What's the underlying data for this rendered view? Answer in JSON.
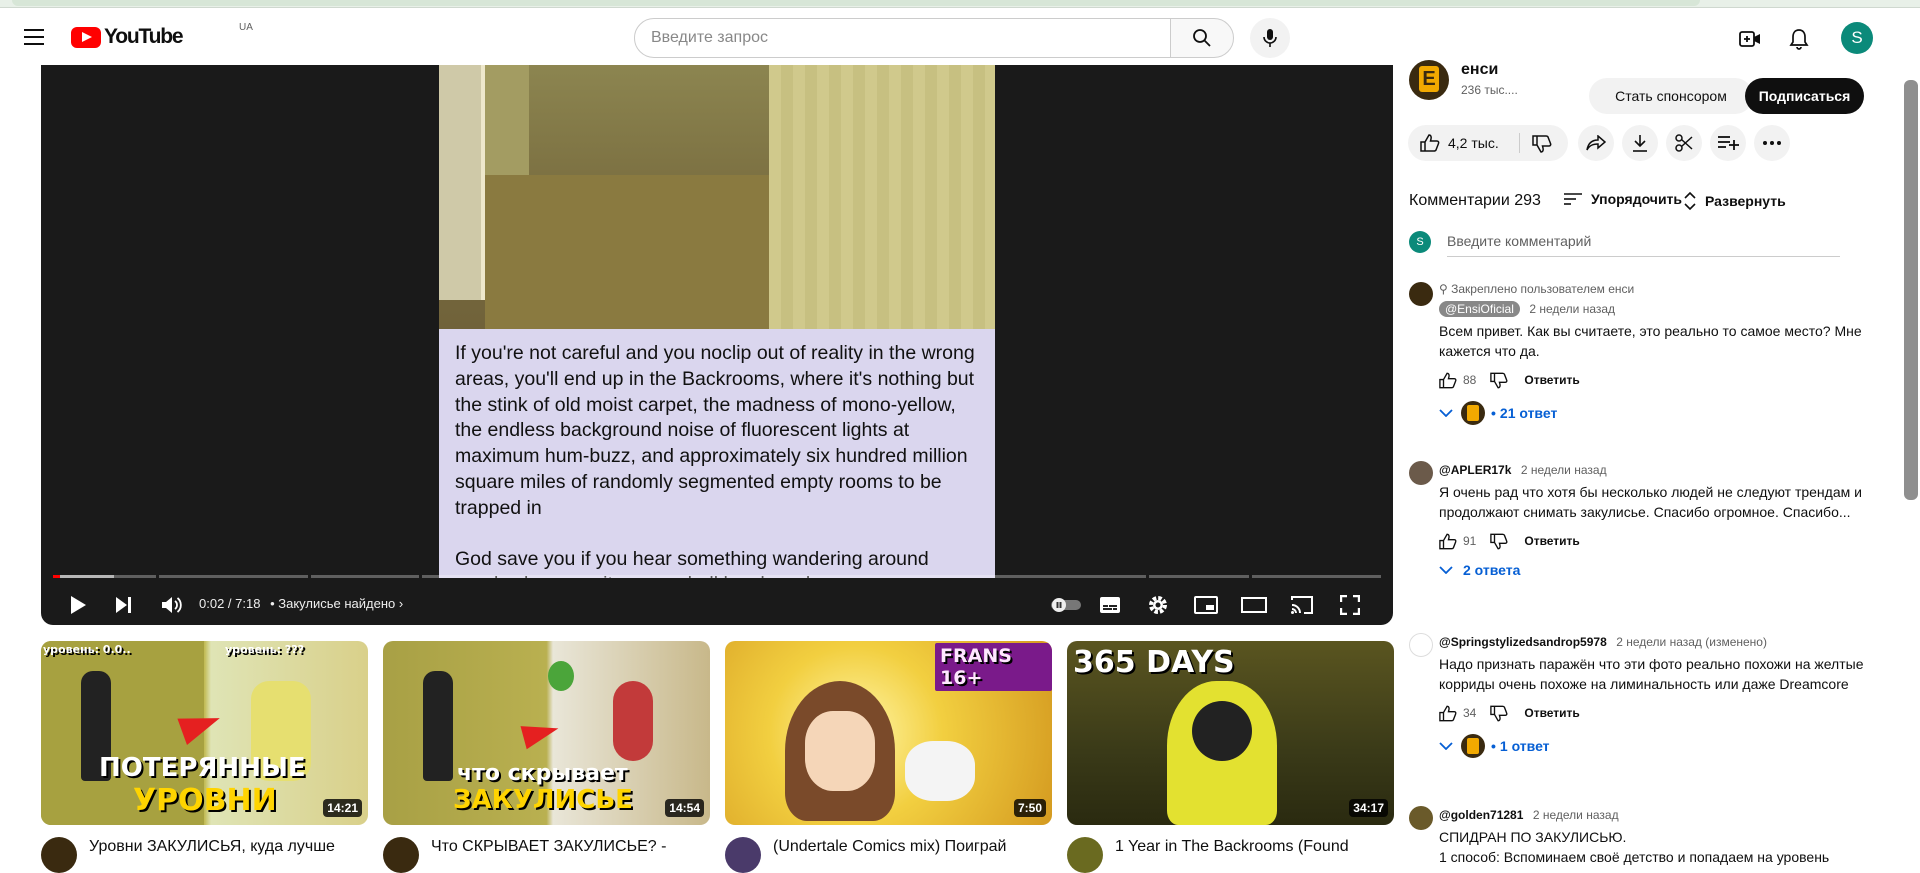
{
  "header": {
    "logo_text": "YouTube",
    "country_code": "UA",
    "search_placeholder": "Введите запрос",
    "user_initial": "S"
  },
  "player": {
    "caption_paragraph_1": "If you're not careful and you noclip out of reality in the wrong areas, you'll end up in the Backrooms, where it's nothing but the stink of old moist carpet, the madness of mono-yellow, the endless background noise of fluorescent lights at maximum hum-buzz, and approximately six hundred million square miles of randomly segmented empty rooms to be trapped in",
    "caption_paragraph_2": "God save you if you hear something wandering around nearby, because it sure as hell has heard you",
    "time": "0:02 / 7:18",
    "chapter": "Закулисье найдено",
    "progress_fraction": 0.005
  },
  "channel": {
    "name": "енси",
    "subscribers": "236 тыс....",
    "sponsor_label": "Стать спонсором",
    "subscribe_label": "Подписаться"
  },
  "actions": {
    "likes": "4,2 тыс."
  },
  "comments": {
    "header": "Комментарии 293",
    "sort_label": "Упорядочить",
    "expand_label": "Развернуть",
    "input_placeholder": "Введите комментарий",
    "my_initial": "S",
    "items": [
      {
        "pinned": "Закреплено пользователем енси",
        "author": "@EnsiOficial",
        "ago": "2 недели назад",
        "text": "Всем привет. Как вы считаете, это реально то самое место? Мне кажется что да.",
        "likes": "88",
        "reply": "Ответить",
        "replies": "21 ответ"
      },
      {
        "author": "@APLER17k",
        "ago": "2 недели назад",
        "text": "Я очень рад что хотя бы несколько людей не следуют трендам и продолжают снимать закулисье. Спасибо огромное. Спасибо...",
        "likes": "91",
        "reply": "Ответить",
        "replies": "2 ответа"
      },
      {
        "author": "@Springstylizedsandrop5978",
        "ago": "2 недели назад (изменено)",
        "text": "Надо признать паражён что эти фото реально похожи на желтые корриды очень похоже на лиминальность или даже Dreamcore",
        "likes": "34",
        "reply": "Ответить",
        "replies": "1 ответ"
      },
      {
        "author": "@golden71281",
        "ago": "2 недели назад",
        "text": "СПИДРАН ПО ЗАКУЛИСЬЮ.",
        "text2": "1 способ: Вспоминаем своё детство и попадаем на уровень"
      }
    ]
  },
  "recommendations": [
    {
      "title": "Уровни ЗАКУЛИСЬЯ, куда лучше",
      "duration": "14:21",
      "overlay_top_left": "уровень: 0.0..",
      "overlay_top_right": "уровень: ???",
      "overlay_line1": "ПОТЕРЯННЫЕ",
      "overlay_line2": "УРОВНИ"
    },
    {
      "title": "Что СКРЫВАЕТ ЗАКУЛИСЬЕ? -",
      "duration": "14:54",
      "overlay_line1": "что скрывает",
      "overlay_line2": "ЗАКУЛИСЬЕ"
    },
    {
      "title": "(Undertale Comics mix) Поиграй",
      "duration": "7:50",
      "overlay_badge": "FRANS 16+"
    },
    {
      "title": "1 Year in The Backrooms (Found",
      "duration": "34:17",
      "overlay_line1": "365 DAYS"
    }
  ]
}
